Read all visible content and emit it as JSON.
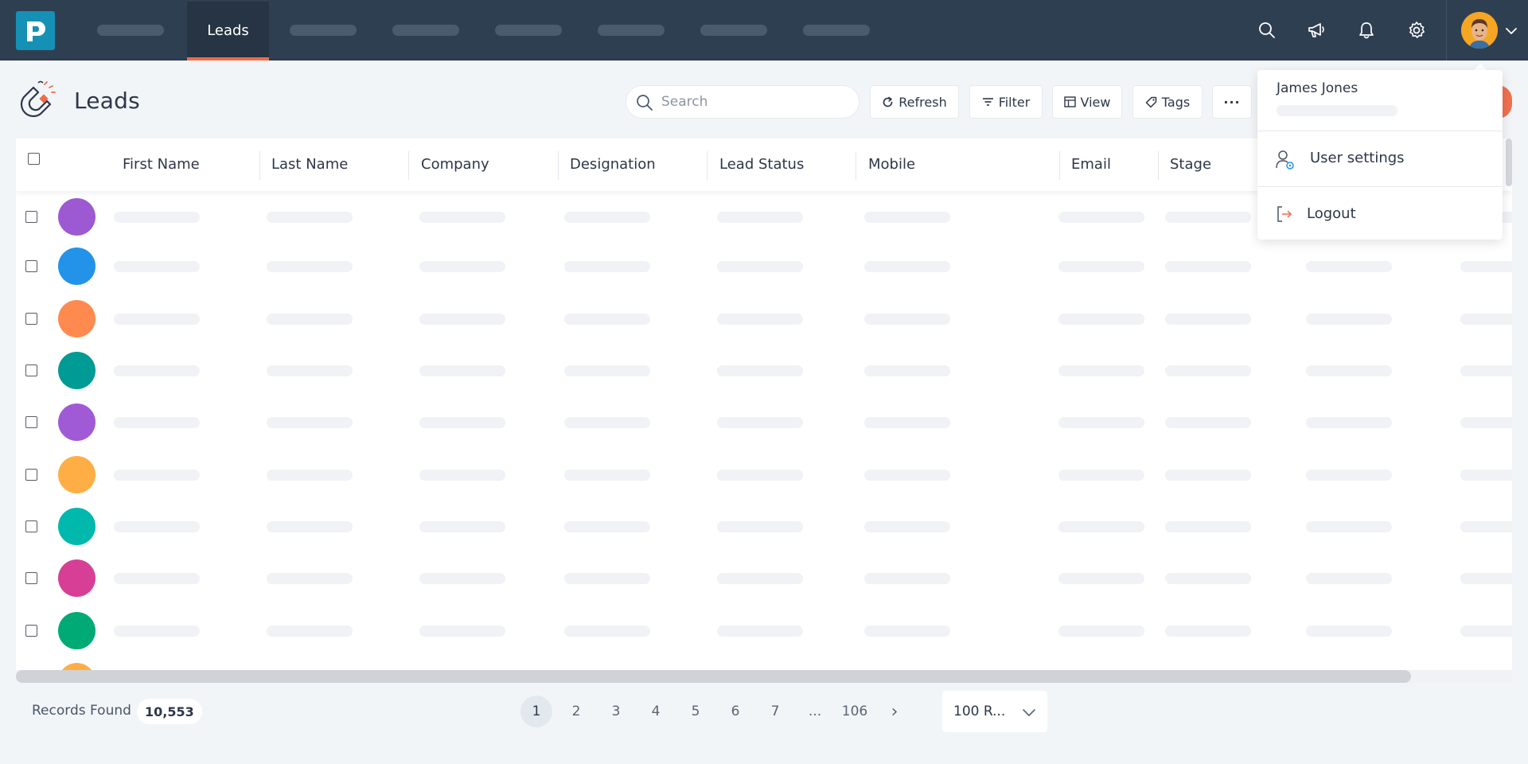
{
  "nav": {
    "active_tab": "Leads"
  },
  "page": {
    "title": "Leads"
  },
  "toolbar": {
    "search_placeholder": "Search",
    "refresh_label": "Refresh",
    "filter_label": "Filter",
    "view_label": "View",
    "tags_label": "Tags",
    "more_label": "···"
  },
  "table": {
    "columns": [
      "First Name",
      "Last Name",
      "Company",
      "Designation",
      "Lead Status",
      "Mobile",
      "Email",
      "Stage"
    ],
    "row_avatar_colors": [
      "#9c59d1",
      "#2393ea",
      "#ff8a50",
      "#009b94",
      "#a05ad6",
      "#ffae45",
      "#00b8ac",
      "#d63f95",
      "#00aa75"
    ]
  },
  "footer": {
    "records_label": "Records Found",
    "records_count": "10,553",
    "pages": [
      "1",
      "2",
      "3",
      "4",
      "5",
      "6",
      "7",
      "...",
      "106"
    ],
    "next_label": "›",
    "rows_per_page": "100 R..."
  },
  "user_menu": {
    "name": "James Jones",
    "settings_label": "User settings",
    "logout_label": "Logout"
  },
  "colors": {
    "nav_bg": "#2f3f52",
    "accent": "#f06b4a",
    "brand": "#1591b6"
  }
}
